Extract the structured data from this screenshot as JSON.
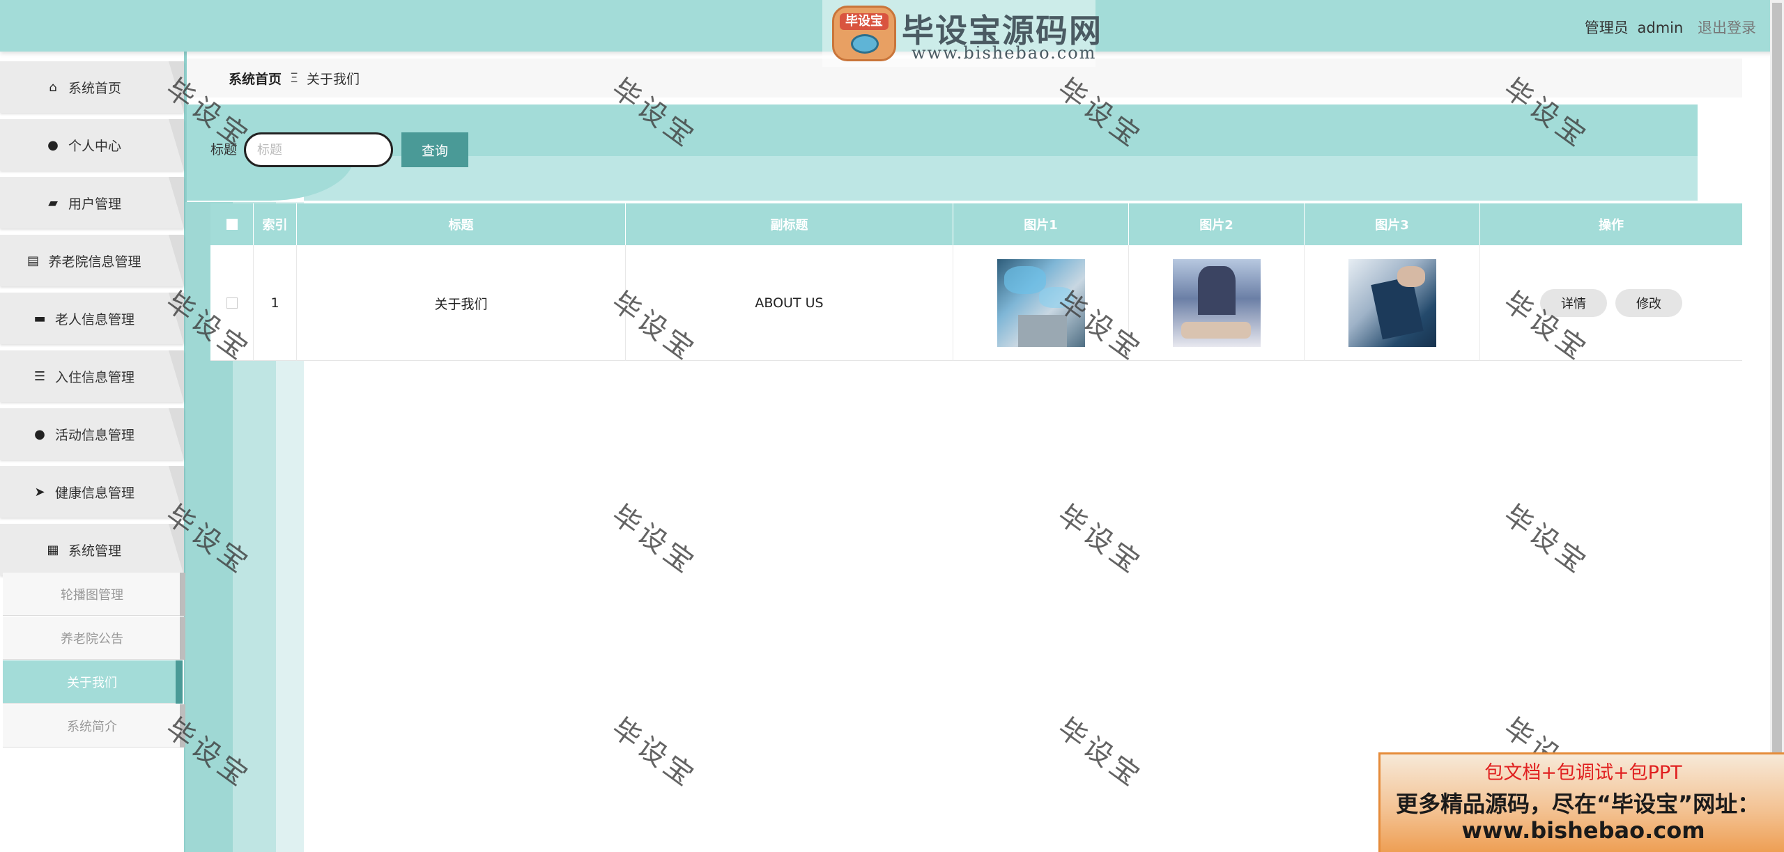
{
  "logo": {
    "badge_text": "毕设宝",
    "title": "毕设宝源码网",
    "url": "www.bishebao.com"
  },
  "header": {
    "user_label": "管理员",
    "username": "admin",
    "logout": "退出登录"
  },
  "sidebar": {
    "items": [
      {
        "label": "系统首页",
        "icon": "home-icon",
        "glyph": "⌂"
      },
      {
        "label": "个人中心",
        "icon": "user-icon",
        "glyph": "●"
      },
      {
        "label": "用户管理",
        "icon": "wallet-icon",
        "glyph": "▰"
      },
      {
        "label": "养老院信息管理",
        "icon": "briefcase-icon",
        "glyph": "▤"
      },
      {
        "label": "老人信息管理",
        "icon": "book-icon",
        "glyph": "▬"
      },
      {
        "label": "入住信息管理",
        "icon": "list-icon",
        "glyph": "☰"
      },
      {
        "label": "活动信息管理",
        "icon": "person-icon",
        "glyph": "●"
      },
      {
        "label": "健康信息管理",
        "icon": "send-icon",
        "glyph": "➤"
      },
      {
        "label": "系统管理",
        "icon": "grid-icon",
        "glyph": "▦"
      }
    ],
    "subitems": [
      {
        "label": "轮播图管理"
      },
      {
        "label": "养老院公告"
      },
      {
        "label": "关于我们"
      },
      {
        "label": "系统简介"
      }
    ]
  },
  "breadcrumb": {
    "home": "系统首页",
    "separator": "Ξ",
    "current": "关于我们"
  },
  "search": {
    "label": "标题",
    "placeholder": "标题",
    "button": "查询"
  },
  "table": {
    "columns": [
      "索引",
      "标题",
      "副标题",
      "图片1",
      "图片2",
      "图片3",
      "操作"
    ],
    "rows": [
      {
        "index": "1",
        "title": "关于我们",
        "subtitle": "ABOUT US",
        "actions": [
          "详情",
          "修改"
        ]
      }
    ]
  },
  "watermark": "毕设宝",
  "ad": {
    "line1": "包文档+包调试+包PPT",
    "line2": "更多精品源码，尽在“毕设宝”网址：",
    "line3": "www.bishebao.com"
  },
  "colors": {
    "accent": "#a3dcd8",
    "accent_dark": "#4a9a97",
    "ad_red": "#e02020"
  }
}
